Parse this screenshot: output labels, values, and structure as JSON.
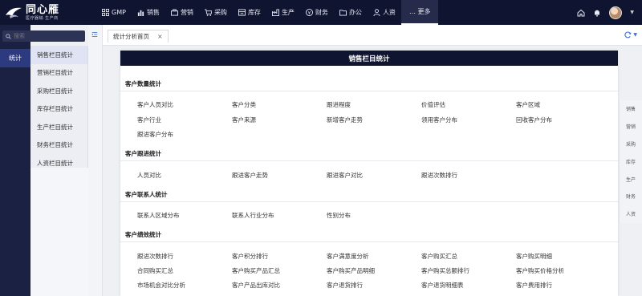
{
  "topbar": {
    "logo_title": "同心雁",
    "logo_subtitle": "医疗器械·生产商",
    "nav": [
      {
        "label": "GMP",
        "icon": "grid-icon"
      },
      {
        "label": "销售",
        "icon": "bar-chart-icon"
      },
      {
        "label": "营销",
        "icon": "briefcase-icon"
      },
      {
        "label": "采购",
        "icon": "cart-icon"
      },
      {
        "label": "库存",
        "icon": "warehouse-icon"
      },
      {
        "label": "生产",
        "icon": "factory-icon"
      },
      {
        "label": "财务",
        "icon": "money-icon"
      },
      {
        "label": "办公",
        "icon": "folder-icon"
      },
      {
        "label": "人资",
        "icon": "person-icon"
      },
      {
        "label": "… 更多",
        "icon": ""
      }
    ],
    "right_icons": [
      "home-icon",
      "bell-icon",
      "avatar"
    ]
  },
  "sidebar": {
    "search_placeholder": "搜索",
    "active_item": "统计"
  },
  "submenu": {
    "items": [
      "销售栏目统计",
      "营销栏目统计",
      "采购栏目统计",
      "库存栏目统计",
      "生产栏目统计",
      "财务栏目统计",
      "人资栏目统计"
    ]
  },
  "tabs": {
    "active_tab": "统计分析首页",
    "close": "×"
  },
  "panel": {
    "title": "销售栏目统计",
    "sections": [
      {
        "title": "客户数量统计",
        "items": [
          "客户人员对比",
          "客户分类",
          "跟进程度",
          "价值评估",
          "客户区域",
          "客户行业",
          "客户来源",
          "新增客户走势",
          "领用客户分布",
          "回收客户分布",
          "跟进客户分布"
        ]
      },
      {
        "title": "客户跟进统计",
        "items": [
          "人员对比",
          "跟进客户走势",
          "跟进客户对比",
          "跟进次数排行"
        ]
      },
      {
        "title": "客户联系人统计",
        "items": [
          "联系人区域分布",
          "联系人行业分布",
          "性别分布"
        ]
      },
      {
        "title": "客户绩效统计",
        "items": [
          "跟进次数排行",
          "客户积分排行",
          "客户满意度分析",
          "客户购买汇总",
          "客户购买明细",
          "合同购买汇总",
          "客户购买产品汇总",
          "客户购买产品明细",
          "客户购买总额排行",
          "客户购买价格分析",
          "市场机会对比分析",
          "客户产品出库对比",
          "客户退货排行",
          "客户退货明细表",
          "客户费用排行"
        ]
      }
    ]
  },
  "right_bar": {
    "items": [
      "销售",
      "营销",
      "采购",
      "库存",
      "生产",
      "财务",
      "人资"
    ]
  },
  "colors": {
    "topbar_bg": "#0f1430",
    "sidebar_bg": "#1b2142",
    "active_side": "#2c3a80",
    "panel_header": "#0f1430"
  }
}
